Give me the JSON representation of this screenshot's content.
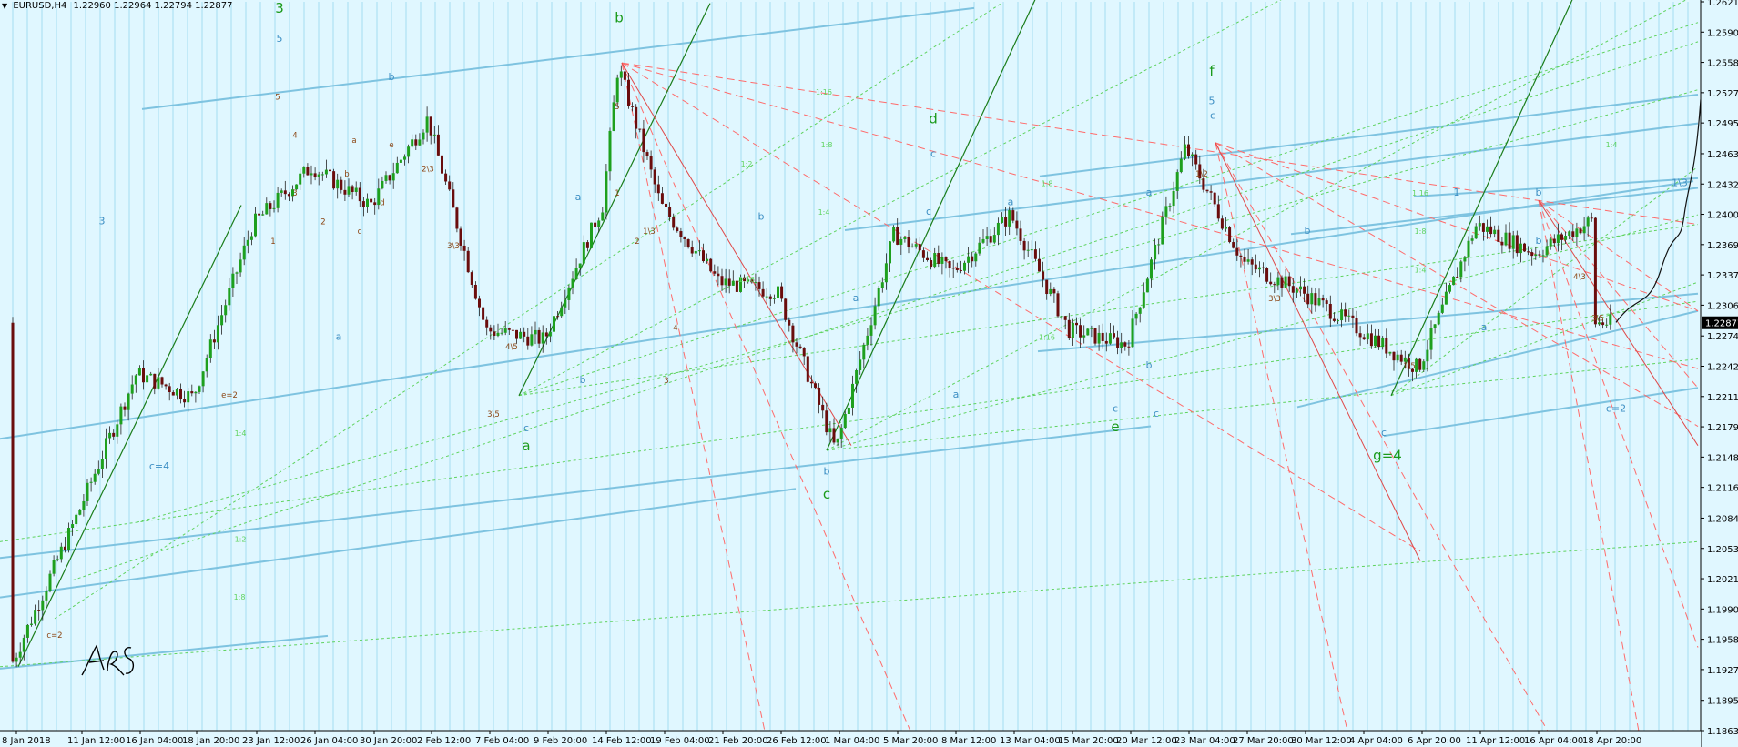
{
  "header": {
    "symbol_timeframe": "EURUSD,H4",
    "ohlc": "1.22960 1.22964 1.22794 1.22877",
    "menu_icon": "triangle-down-icon"
  },
  "colors": {
    "background": "#e0f7ff",
    "grid": "#8fd3ee",
    "bull": "#1ea01e",
    "bear": "#6a0d0d",
    "channel": "#7ec3e0",
    "fan_green": "#5fd35f",
    "fan_red": "#ff6b6b",
    "trend_dark_green": "#1a7d1a",
    "label_brown": "#8b4513",
    "label_blue": "#3d8fc4",
    "label_green": "#1a9a1a",
    "current_price_tag": "#000000"
  },
  "chart_data": {
    "type": "candlestick",
    "instrument": "EURUSD",
    "timeframe": "H4",
    "ohlc_current": {
      "open": 1.2296,
      "high": 1.22964,
      "low": 1.22794,
      "close": 1.22877
    },
    "current_price_label": "1.22877",
    "ylim": [
      1.18635,
      1.26215
    ],
    "y_ticks": [
      "1.26215",
      "1.25900",
      "1.25585",
      "1.25270",
      "1.24955",
      "1.24635",
      "1.24320",
      "1.24005",
      "1.23690",
      "1.23375",
      "1.23060",
      "1.22740",
      "1.22425",
      "1.22110",
      "1.21795",
      "1.21480",
      "1.21165",
      "1.20845",
      "1.20530",
      "1.20215",
      "1.19900",
      "1.19585",
      "1.19270",
      "1.18950",
      "1.18635"
    ],
    "x_ticks": [
      "8 Jan 2018",
      "11 Jan 12:00",
      "16 Jan 04:00",
      "18 Jan 20:00",
      "23 Jan 12:00",
      "26 Jan 04:00",
      "30 Jan 20:00",
      "2 Feb 12:00",
      "7 Feb 04:00",
      "9 Feb 20:00",
      "14 Feb 12:00",
      "19 Feb 04:00",
      "21 Feb 20:00",
      "26 Feb 12:00",
      "1 Mar 04:00",
      "5 Mar 20:00",
      "8 Mar 12:00",
      "13 Mar 04:00",
      "15 Mar 20:00",
      "20 Mar 12:00",
      "23 Mar 04:00",
      "27 Mar 20:00",
      "30 Mar 12:00",
      "4 Apr 04:00",
      "6 Apr 20:00",
      "11 Apr 12:00",
      "16 Apr 04:00",
      "18 Apr 20:00"
    ],
    "x_range": [
      "8 Jan 2018",
      "18 Apr 20:00"
    ],
    "price_path_anchors": [
      {
        "x": "8 Jan 2018",
        "y": 1.1935
      },
      {
        "x": "11 Jan 12:00",
        "y": 1.209
      },
      {
        "x": "16 Jan 04:00",
        "y": 1.2235
      },
      {
        "x": "18 Jan 20:00",
        "y": 1.221
      },
      {
        "x": "23 Jan 12:00",
        "y": 1.239
      },
      {
        "x": "26 Jan 04:00",
        "y": 1.245
      },
      {
        "x": "30 Jan 20:00",
        "y": 1.241
      },
      {
        "x": "2 Feb 12:00",
        "y": 1.25
      },
      {
        "x": "7 Feb 04:00",
        "y": 1.228
      },
      {
        "x": "9 Feb 20:00",
        "y": 1.227
      },
      {
        "x": "14 Feb 12:00",
        "y": 1.241
      },
      {
        "x": "16 Feb 12:00",
        "y": 1.2555
      },
      {
        "x": "19 Feb 04:00",
        "y": 1.241
      },
      {
        "x": "21 Feb 20:00",
        "y": 1.233
      },
      {
        "x": "26 Feb 12:00",
        "y": 1.232
      },
      {
        "x": "1 Mar 04:00",
        "y": 1.2155
      },
      {
        "x": "5 Mar 20:00",
        "y": 1.238
      },
      {
        "x": "8 Mar 12:00",
        "y": 1.234
      },
      {
        "x": "13 Mar 04:00",
        "y": 1.24
      },
      {
        "x": "15 Mar 20:00",
        "y": 1.228
      },
      {
        "x": "20 Mar 12:00",
        "y": 1.2265
      },
      {
        "x": "23 Mar 04:00",
        "y": 1.247
      },
      {
        "x": "27 Mar 20:00",
        "y": 1.235
      },
      {
        "x": "30 Mar 12:00",
        "y": 1.232
      },
      {
        "x": "4 Apr 04:00",
        "y": 1.228
      },
      {
        "x": "6 Apr 20:00",
        "y": 1.224
      },
      {
        "x": "11 Apr 12:00",
        "y": 1.239
      },
      {
        "x": "16 Apr 04:00",
        "y": 1.236
      },
      {
        "x": "18 Apr 20:00",
        "y": 1.2395
      },
      {
        "x": "18 Apr 20:00",
        "y": 1.22877
      }
    ],
    "wave_labels": {
      "green_large": [
        "3",
        "b",
        "d",
        "f",
        "a",
        "c",
        "e",
        "g=4"
      ],
      "blue": [
        "5",
        "b",
        "c=4",
        "3",
        "c",
        "b",
        "a",
        "a",
        "c",
        "c",
        "b",
        "a",
        "5",
        "a",
        "c",
        "c",
        "c",
        "b",
        "1",
        "b",
        "c=2",
        "1\\3",
        "b",
        "a",
        "c",
        "a",
        "b",
        "a",
        "b"
      ],
      "brown_small": [
        "5",
        "4",
        "3",
        "2",
        "1",
        "e",
        "d",
        "c",
        "b",
        "a",
        "4\\5",
        "3\\5",
        "2\\3",
        "1\\3",
        "3\\3",
        "c=2",
        "e=2",
        "5",
        "4",
        "3",
        "2",
        "1",
        "1\\5",
        "4\\3",
        "1\\2",
        "3\\3",
        "3\\5"
      ],
      "ratio_labels": [
        "1:16",
        "1:8",
        "1:4",
        "1:2",
        "1:16",
        "1:8",
        "1:4",
        "1:16",
        "1:8",
        "1:4",
        "1:2",
        "1:8",
        "1:16",
        "1:4"
      ]
    },
    "grid": true,
    "legend": "none",
    "signature_text": "ARS"
  }
}
